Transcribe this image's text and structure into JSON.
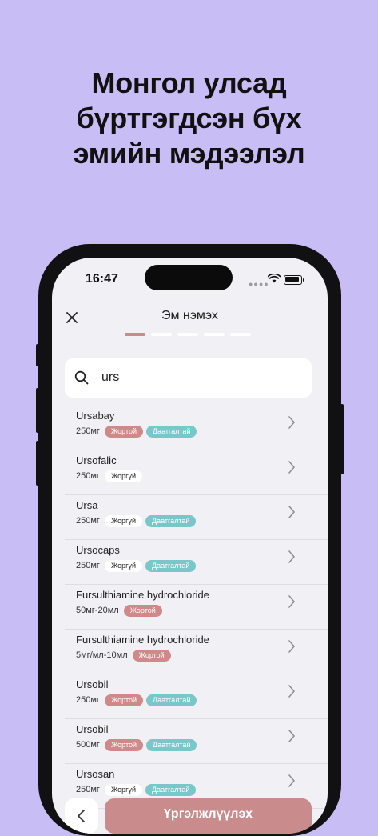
{
  "headline": {
    "line1": "Монгол улсад",
    "line2": "бүртгэгдсэн бүх",
    "line3": "эмийн мэдээлэл"
  },
  "status_bar": {
    "time": "16:47"
  },
  "screen": {
    "title": "Эм нэмэх",
    "step_count": 5,
    "active_step": 1
  },
  "search": {
    "value": "urs"
  },
  "medicines": [
    {
      "name": "Ursabay",
      "dose": "250мг",
      "tags": [
        {
          "label": "Жортой",
          "kind": "prescription"
        },
        {
          "label": "Даатгалтай",
          "kind": "insured"
        }
      ]
    },
    {
      "name": "Ursofalic",
      "dose": "250мг",
      "tags": [
        {
          "label": "Жоргүй",
          "kind": "otc"
        }
      ]
    },
    {
      "name": "Ursa",
      "dose": "250мг",
      "tags": [
        {
          "label": "Жоргүй",
          "kind": "otc"
        },
        {
          "label": "Даатгалтай",
          "kind": "insured"
        }
      ]
    },
    {
      "name": "Ursocaps",
      "dose": "250мг",
      "tags": [
        {
          "label": "Жоргүй",
          "kind": "otc"
        },
        {
          "label": "Даатгалтай",
          "kind": "insured"
        }
      ]
    },
    {
      "name": "Fursulthiamine hydrochloride",
      "dose": "50мг-20мл",
      "tags": [
        {
          "label": "Жортой",
          "kind": "prescription"
        }
      ]
    },
    {
      "name": "Fursulthiamine hydrochloride",
      "dose": "5мг/мл-10мл",
      "tags": [
        {
          "label": "Жортой",
          "kind": "prescription"
        }
      ]
    },
    {
      "name": "Ursobil",
      "dose": "250мг",
      "tags": [
        {
          "label": "Жортой",
          "kind": "prescription"
        },
        {
          "label": "Даатгалтай",
          "kind": "insured"
        }
      ]
    },
    {
      "name": "Ursobil",
      "dose": "500мг",
      "tags": [
        {
          "label": "Жортой",
          "kind": "prescription"
        },
        {
          "label": "Даатгалтай",
          "kind": "insured"
        }
      ]
    },
    {
      "name": "Ursosan",
      "dose": "250мг",
      "tags": [
        {
          "label": "Жоргүй",
          "kind": "otc"
        },
        {
          "label": "Даатгалтай",
          "kind": "insured"
        }
      ]
    }
  ],
  "footer": {
    "continue_label": "Үргэлжлүүлэх"
  },
  "colors": {
    "background": "#c9bdf5",
    "prescription": "#cf8989",
    "insured": "#79c7c9",
    "continue_button": "#c98b8b"
  }
}
